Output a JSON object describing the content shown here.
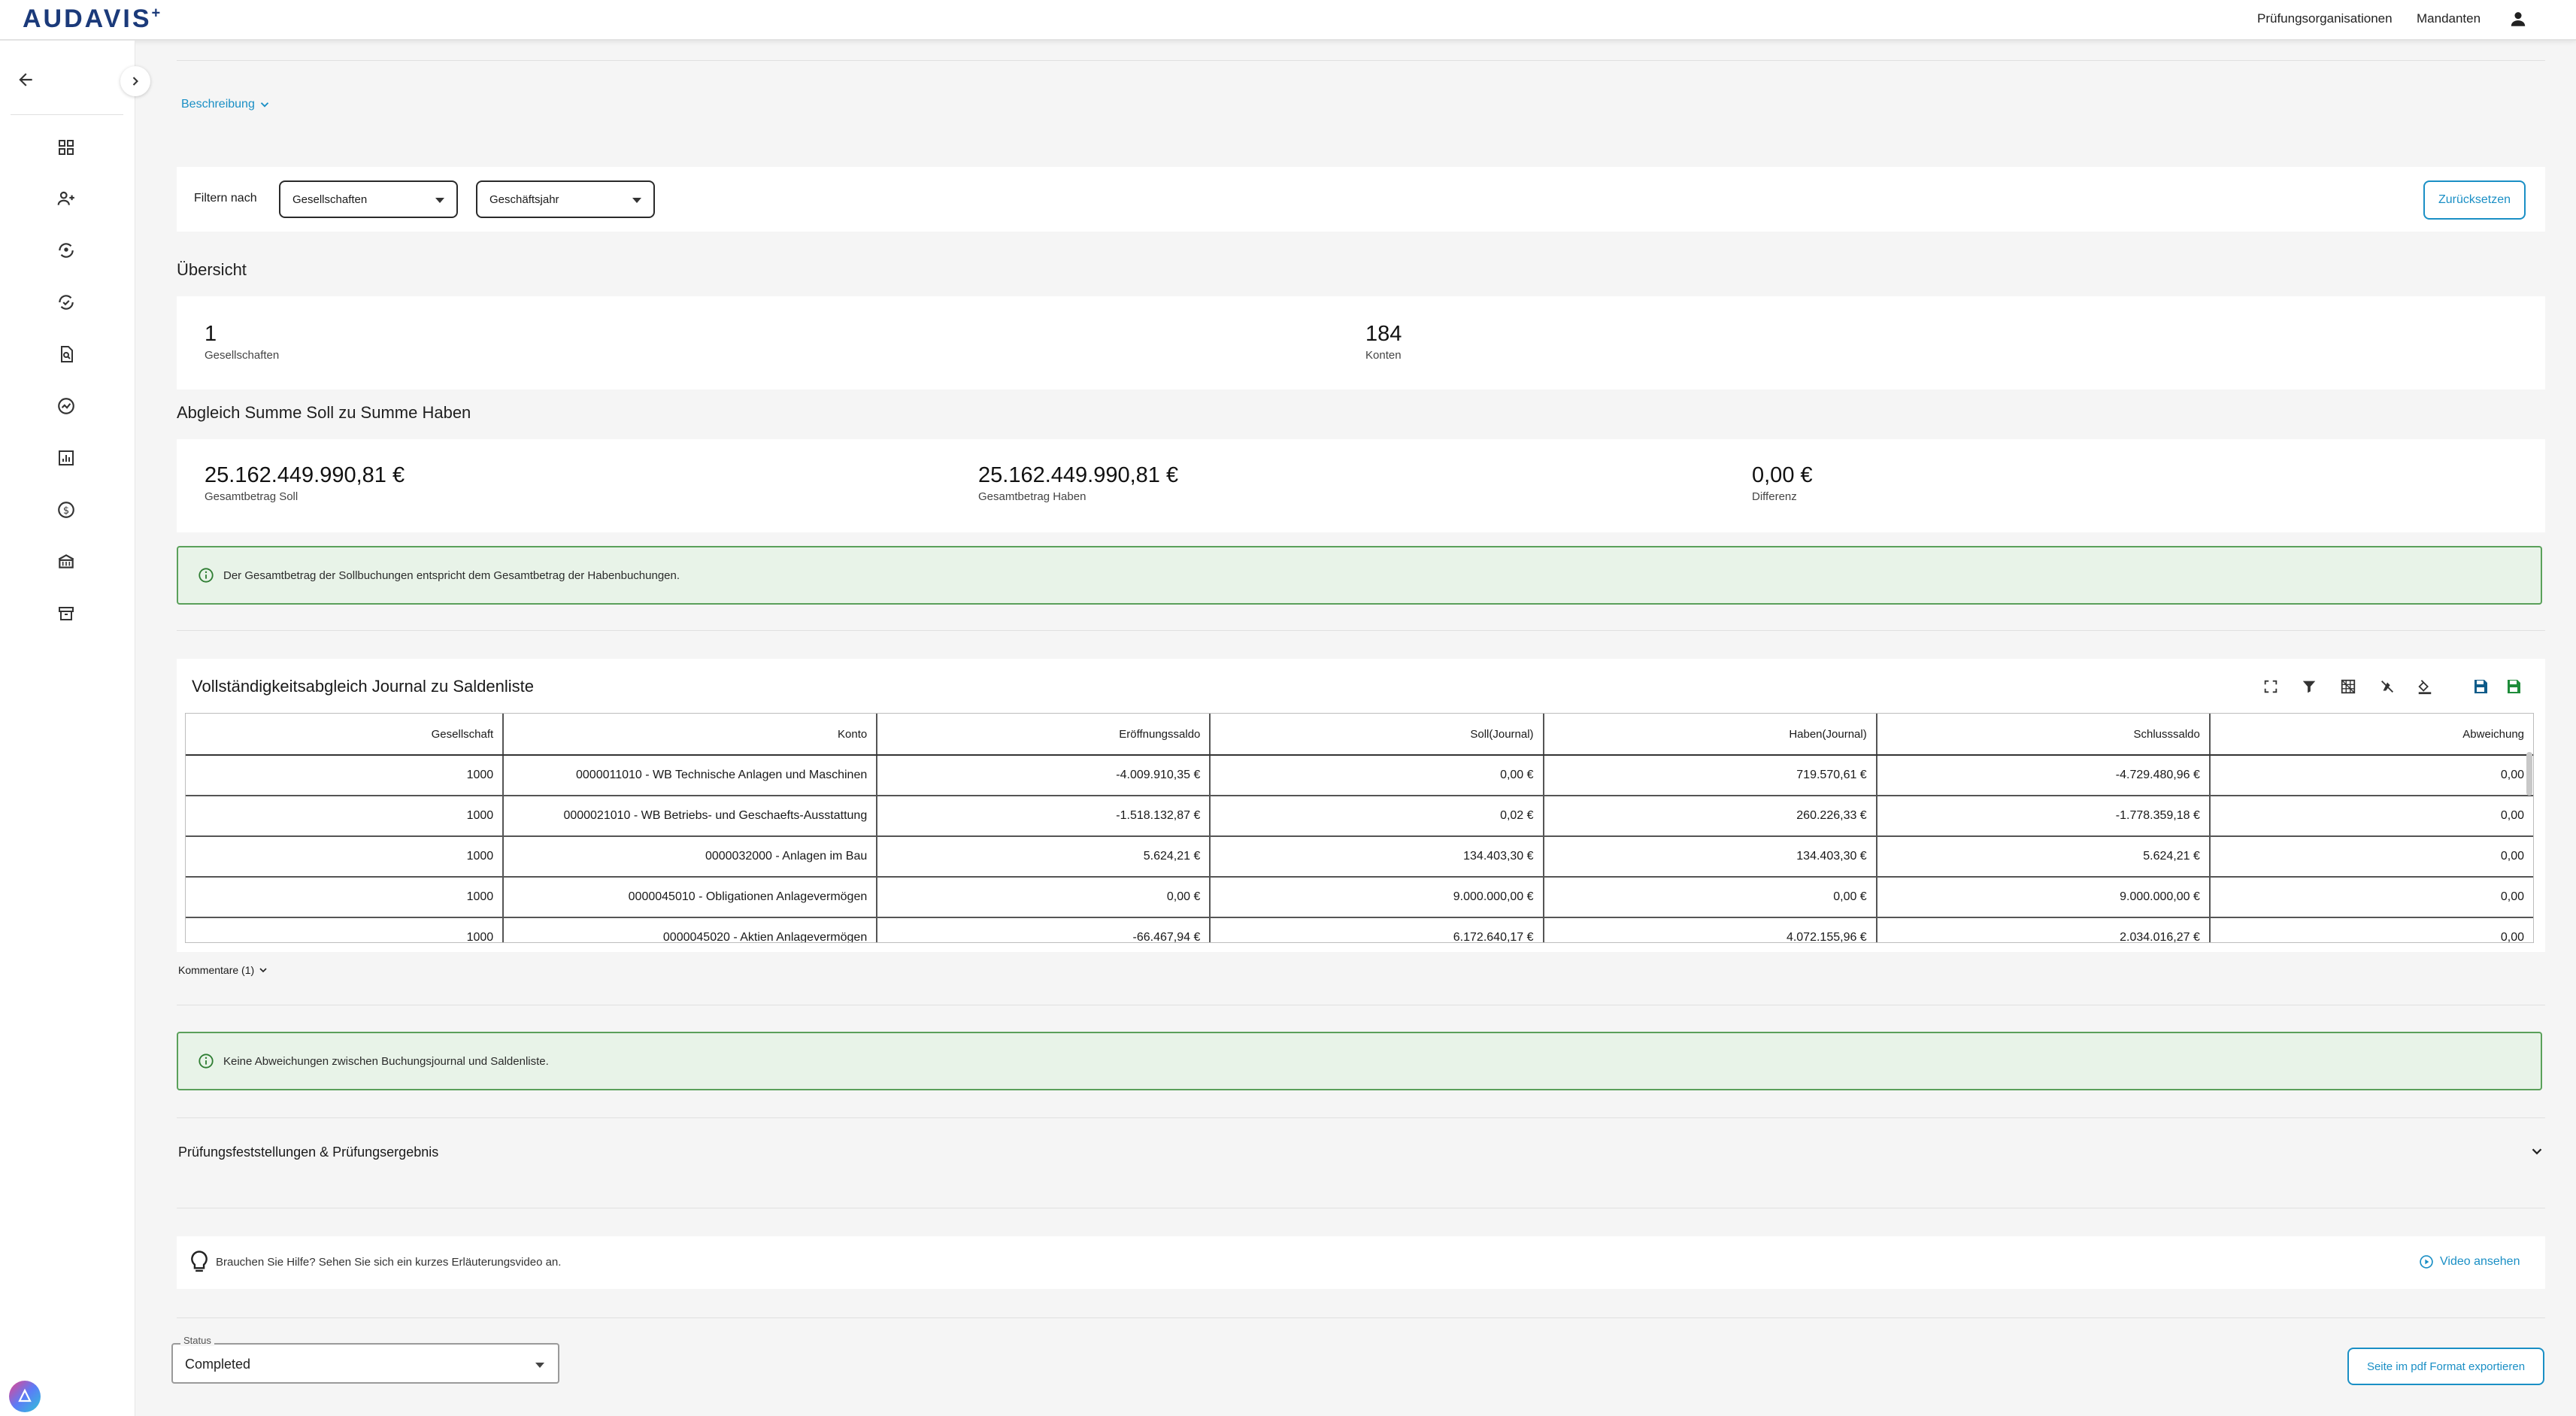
{
  "app": {
    "logo": "AUDAVIS",
    "logo_sup": "+"
  },
  "topnav": {
    "organizations": "Prüfungsorganisationen",
    "clients": "Mandanten"
  },
  "description_toggle": "Beschreibung",
  "filter": {
    "label": "Filtern nach",
    "companies_select": "Gesellschaften",
    "fiscal_year_select": "Geschäftsjahr",
    "reset_button": "Zurücksetzen"
  },
  "overview": {
    "title": "Übersicht",
    "companies_count": "1",
    "companies_label": "Gesellschaften",
    "accounts_count": "184",
    "accounts_label": "Konten"
  },
  "balance_check": {
    "title": "Abgleich Summe Soll zu Summe Haben",
    "debit_total": "25.162.449.990,81 €",
    "debit_label": "Gesamtbetrag Soll",
    "credit_total": "25.162.449.990,81 €",
    "credit_label": "Gesamtbetrag Haben",
    "difference": "0,00 €",
    "difference_label": "Differenz",
    "info": "Der Gesamtbetrag der Sollbuchungen entspricht dem Gesamtbetrag der Habenbuchungen."
  },
  "completeness": {
    "title": "Vollständigkeitsabgleich Journal zu Saldenliste",
    "columns": [
      "Gesellschaft",
      "Konto",
      "Eröffnungssaldo",
      "Soll(Journal)",
      "Haben(Journal)",
      "Schlusssaldo",
      "Abweichung"
    ],
    "rows": [
      [
        "1000",
        "0000011010 - WB Technische Anlagen und Maschinen",
        "-4.009.910,35 €",
        "0,00 €",
        "719.570,61 €",
        "-4.729.480,96 €",
        "0,00"
      ],
      [
        "1000",
        "0000021010 - WB Betriebs- und Geschaefts-Ausstattung",
        "-1.518.132,87 €",
        "0,02 €",
        "260.226,33 €",
        "-1.778.359,18 €",
        "0,00"
      ],
      [
        "1000",
        "0000032000 - Anlagen im Bau",
        "5.624,21 €",
        "134.403,30 €",
        "134.403,30 €",
        "5.624,21 €",
        "0,00"
      ],
      [
        "1000",
        "0000045010 - Obligationen Anlagevermögen",
        "0,00 €",
        "9.000.000,00 €",
        "0,00 €",
        "9.000.000,00 €",
        "0,00"
      ],
      [
        "1000",
        "0000045020 - Aktien Anlagevermögen",
        "-66.467,94 €",
        "6.172.640,17 €",
        "4.072.155,96 €",
        "2.034.016,27 €",
        "0,00"
      ]
    ],
    "comments_toggle": "Kommentare (1)",
    "info": "Keine Abweichungen zwischen Buchungsjournal und Saldenliste."
  },
  "findings": {
    "title": "Prüfungsfeststellungen & Prüfungsergebnis"
  },
  "help": {
    "text": "Brauchen Sie Hilfe? Sehen Sie sich ein kurzes Erläuterungsvideo an.",
    "video_link": "Video ansehen"
  },
  "status": {
    "label": "Status",
    "value": "Completed"
  },
  "export_button": "Seite im pdf Format exportieren",
  "colors": {
    "accent": "#1a8fc5",
    "brand": "#1b3a7a",
    "success_bg": "#e8f3e8",
    "success_border": "#5aa05a"
  }
}
